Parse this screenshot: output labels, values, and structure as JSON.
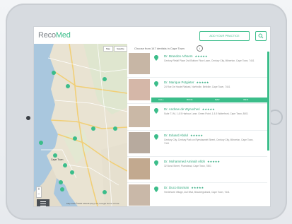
{
  "app": {
    "logo_part1": "Reco",
    "logo_part2": "Med",
    "cta_label": "ADD YOUR PRACTICE",
    "brand_color": "#3bbd8a"
  },
  "map": {
    "tab_map": "Map",
    "tab_satellite": "Satellite",
    "city_label": "Cape Town",
    "zoom_in": "+",
    "zoom_out": "−",
    "footer": "Map data ©2015 AfriGIS (Pty) Ltd, Google  Terms of Use"
  },
  "list": {
    "title": "Choose from 147 dentists in Cape Town",
    "info_icon": "i",
    "action_labels": [
      "CALL",
      "BOOK",
      "MAP",
      "INFO"
    ],
    "doctors": [
      {
        "name": "Dr. Brandon Arhsem",
        "stars": "★★★★★",
        "address": "Century Retail Place 2nd Bottom Floor Lawn, Century City, Milnerton, Cape Town, 7441",
        "photo": "#c7b6a5"
      },
      {
        "name": "Dr. Marique Potgieter",
        "stars": "★★★★★",
        "address": "24 Rue De Haute Rialsed, Northville, Bellville, Cape Town, 7441",
        "photo": "#d5b7a8"
      },
      {
        "name": "Dr. Andrew de Wynocheri",
        "stars": "★★★★★",
        "address": "Suite 71 M, 1 & 5 Harbour Lane, Green Point, 1 & 5 Waterfront, Cape Town, 8001",
        "photo": "#cab8a6"
      },
      {
        "name": "Dr. Eduard Abdul",
        "stars": "★★★★★",
        "address": "Century City, Century Park on Ryevlasmiet Street, Century City, Milnerton, Cape Town, 7441",
        "photo": "#b7aa9e"
      },
      {
        "name": "Dr. Mohammed Aminah Alloh",
        "stars": "★★★★★",
        "address": "32 Bond Street, Plumstead, Cape Town, 7801",
        "photo": "#c2a98f"
      },
      {
        "name": "Dr. Duco Bosman",
        "stars": "★★★★★",
        "address": "Vredehoek Village, Zuil Blvd, Bloubergstrand, Cape Town, 7441",
        "photo": "#c9b8a8"
      }
    ]
  }
}
